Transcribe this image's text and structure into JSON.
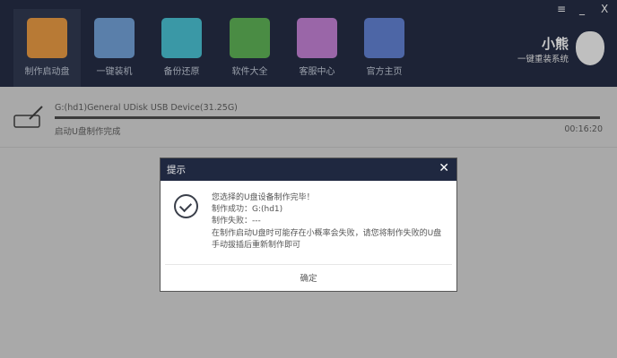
{
  "nav": {
    "tabs": [
      {
        "label": "制作启动盘",
        "color": "#b87a35"
      },
      {
        "label": "一键装机",
        "color": "#5a7faa"
      },
      {
        "label": "备份还原",
        "color": "#3a98a6"
      },
      {
        "label": "软件大全",
        "color": "#4a8c44"
      },
      {
        "label": "客服中心",
        "color": "#9a66a8"
      },
      {
        "label": "官方主页",
        "color": "#4d66a6"
      }
    ]
  },
  "window_controls": {
    "menu": "≡",
    "minimize": "_",
    "close": "X"
  },
  "logo": {
    "title": "小熊",
    "subtitle": "一键重装系统"
  },
  "device": {
    "name": "G:(hd1)General UDisk USB Device(31.25G)",
    "status": "启动U盘制作完成",
    "elapsed": "00:16:20",
    "progress": 100
  },
  "dialog": {
    "title": "提示",
    "close": "✕",
    "lines": [
      "您选择的U盘设备制作完毕！",
      "制作成功：G:(hd1)",
      "制作失败：---",
      "在制作启动U盘时可能存在小概率会失败，请您将制作失败的U盘手动拔插后重新制作即可"
    ],
    "ok": "确定"
  }
}
